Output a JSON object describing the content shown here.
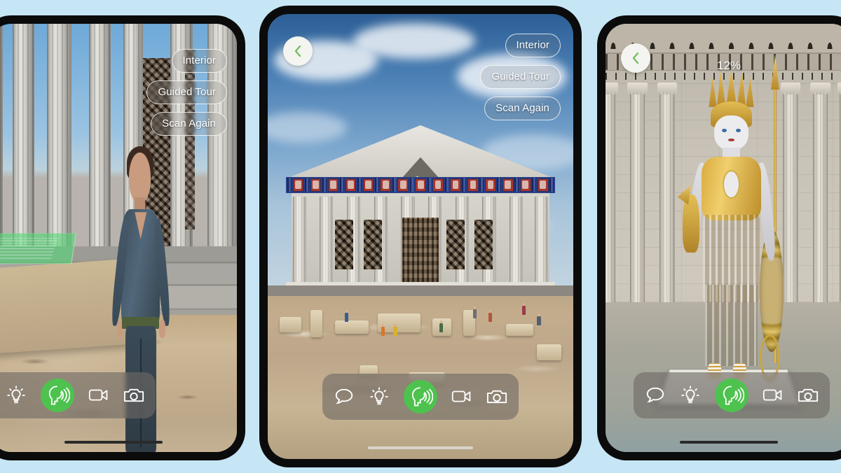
{
  "page": {
    "background_color": "#c7e6f5",
    "title": "AR Parthenon Experience - three tablet screens"
  },
  "devices": [
    {
      "id": "left",
      "scene_label": "AR view of temple portico with virtual guide avatar",
      "controls": {
        "pills": [
          "Interior",
          "Guided Tour",
          "Scan Again"
        ],
        "back_button": null,
        "progress": null,
        "home_indicator_color": "#2a2a2a"
      }
    },
    {
      "id": "middle",
      "scene_label": "AR reconstruction of the Parthenon over the real Acropolis ruins",
      "controls": {
        "pills": [
          "Interior",
          "Guided Tour",
          "Scan Again"
        ],
        "back_button": "chevron-left",
        "progress": null,
        "home_indicator_color": "#d8d4cc"
      }
    },
    {
      "id": "right",
      "scene_label": "Interior view with the gold-and-ivory Athena Parthenos statue",
      "controls": {
        "pills": [],
        "back_button": "chevron-left",
        "progress": "12%",
        "home_indicator_color": "#2a2a2a"
      }
    }
  ],
  "toolbar": {
    "items": [
      {
        "name": "chat-bubble-icon",
        "label": "Chat",
        "active": false
      },
      {
        "name": "lightbulb-icon",
        "label": "Hints",
        "active": false
      },
      {
        "name": "speaking-head-icon",
        "label": "Narration",
        "active": true
      },
      {
        "name": "video-camera-icon",
        "label": "Record video",
        "active": false
      },
      {
        "name": "photo-camera-icon",
        "label": "Take photo",
        "active": false
      }
    ],
    "active_color": "#4ec24e",
    "background_color": "rgba(110,105,100,0.62)"
  },
  "colors": {
    "accent_green": "#4ec24e",
    "back_chevron_green": "#6bbf59",
    "pill_border": "rgba(255,255,255,0.78)",
    "page_bg": "#c7e6f5"
  }
}
